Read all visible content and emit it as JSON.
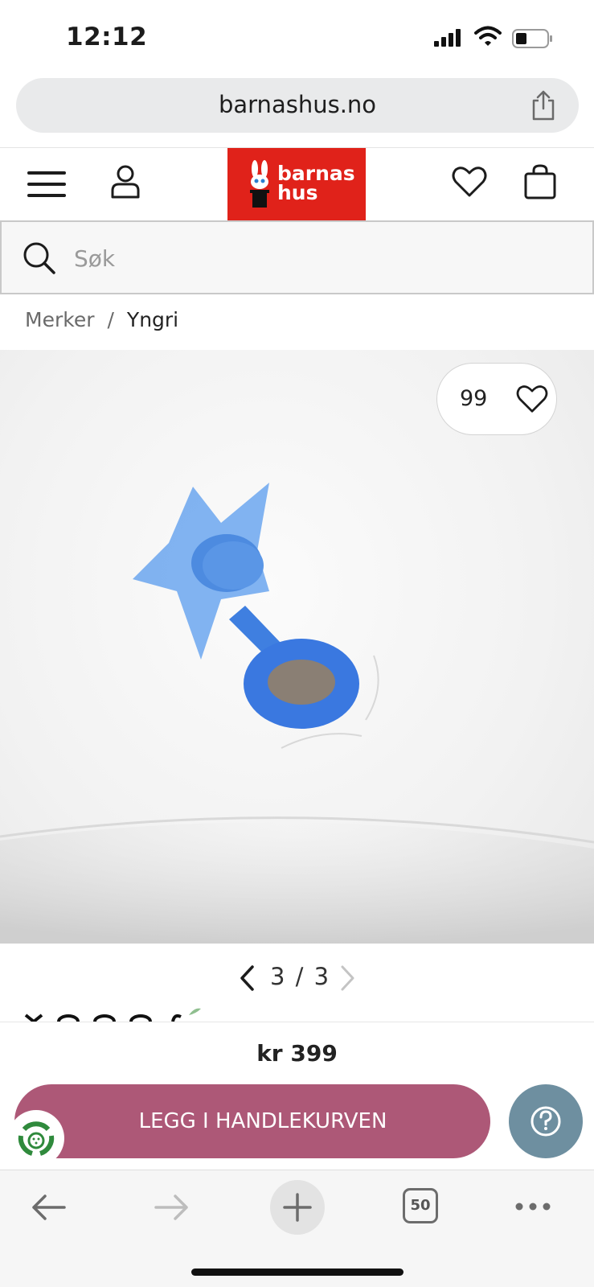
{
  "status_bar": {
    "time": "12:12"
  },
  "browser": {
    "url": "barnashus.no",
    "tab_count": "50"
  },
  "header": {
    "logo_line1": "barnas",
    "logo_line2": "hus",
    "brand_color": "#e0221a"
  },
  "search": {
    "placeholder": "Søk"
  },
  "breadcrumb": {
    "items": [
      "Merker",
      "Yngri"
    ],
    "separator": "/"
  },
  "product": {
    "favorite_count": "99",
    "image_description_icon": "blue-star-drain-stopper",
    "pager": {
      "current": "3",
      "separator": "/",
      "total": "3"
    },
    "price": "kr 399",
    "add_to_cart_label": "LEGG I HANDLEKURVEN",
    "accent_color": "#ad5877"
  },
  "help": {
    "icon": "question-icon",
    "color": "#6e8fa0"
  }
}
